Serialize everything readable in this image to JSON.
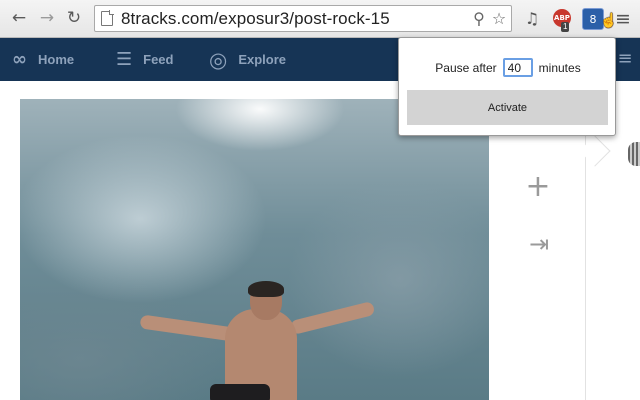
{
  "browser": {
    "url": "8tracks.com/exposur3/post-rock-15",
    "back_icon": "←",
    "forward_icon": "→",
    "reload_icon": "↻",
    "search_icon": "⚲",
    "star_icon": "☆",
    "music_icon": "♫",
    "abp_label": "ABP",
    "abp_badge": "1",
    "active_ext_label": "8",
    "menu_icon": "≡"
  },
  "site_nav": {
    "logo_icon": "∞",
    "items": [
      {
        "label": "Home",
        "icon": "∞"
      },
      {
        "label": "Feed",
        "icon": "☰"
      },
      {
        "label": "Explore",
        "icon": "◎"
      }
    ]
  },
  "actions": {
    "add_icon": "+",
    "share_icon": "⇥"
  },
  "popup": {
    "pause_label": "Pause after",
    "minutes_value": "40",
    "minutes_unit": "minutes",
    "activate_label": "Activate"
  }
}
